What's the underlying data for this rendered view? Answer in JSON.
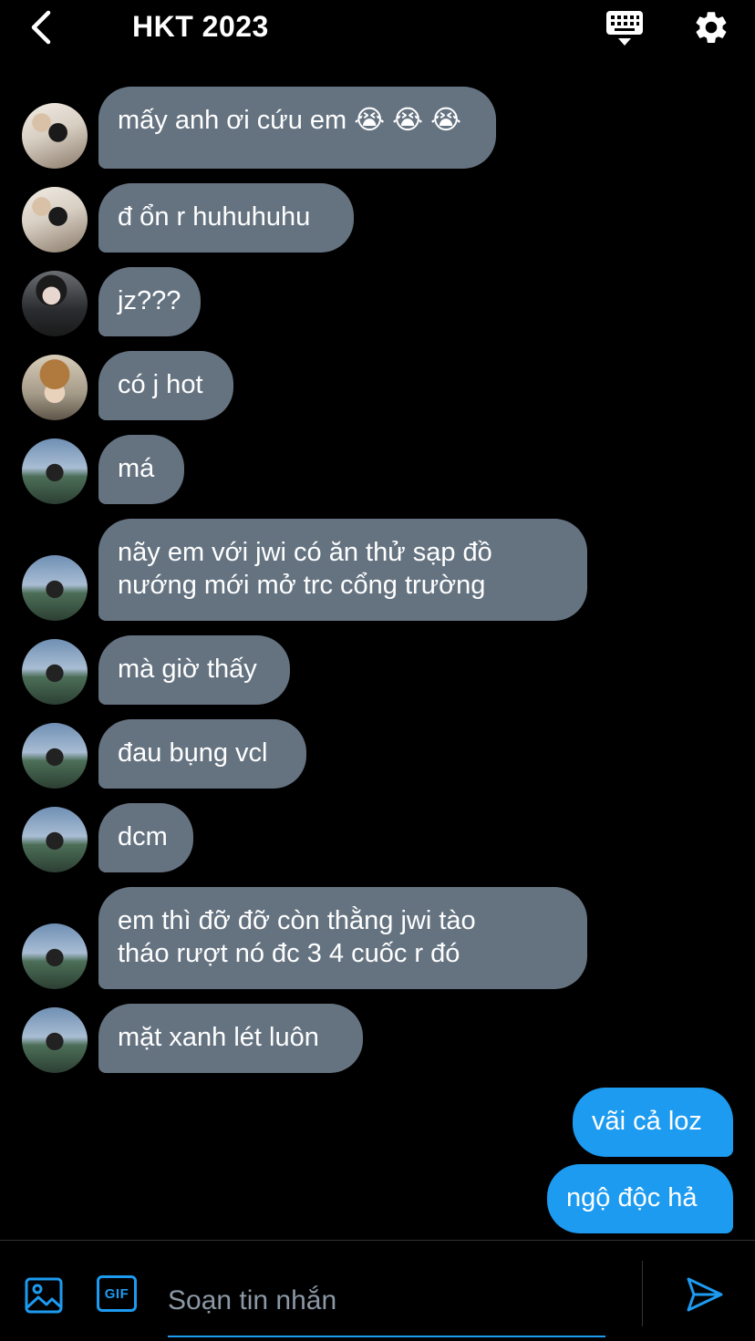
{
  "header": {
    "title": "HKT 2023",
    "icons": {
      "back": "chevron-left-icon",
      "keyboard": "keyboard-icon",
      "settings": "gear-icon"
    }
  },
  "messages": [
    {
      "sender": "other",
      "avatar": "a",
      "text": "mấy anh ơi cứu em 😭 😭 😭"
    },
    {
      "sender": "other",
      "avatar": "a",
      "text": "đ ổn r huhuhuhu"
    },
    {
      "sender": "other",
      "avatar": "b",
      "text": "jz???"
    },
    {
      "sender": "other",
      "avatar": "c",
      "text": "có j hot"
    },
    {
      "sender": "other",
      "avatar": "d",
      "text": "má"
    },
    {
      "sender": "other",
      "avatar": "d",
      "text": "nãy em với jwi có ăn thử sạp đồ\nnướng mới mở trc cổng trường"
    },
    {
      "sender": "other",
      "avatar": "d",
      "text": "mà giờ thấy"
    },
    {
      "sender": "other",
      "avatar": "d",
      "text": "đau bụng vcl"
    },
    {
      "sender": "other",
      "avatar": "d",
      "text": "dcm"
    },
    {
      "sender": "other",
      "avatar": "d",
      "text": "em thì đỡ đỡ còn thằng jwi tào\ntháo rượt nó đc 3 4 cuốc r đó"
    },
    {
      "sender": "other",
      "avatar": "d",
      "text": "mặt xanh lét luôn"
    },
    {
      "sender": "me",
      "text": "vãi cả loz"
    },
    {
      "sender": "me",
      "text": "ngộ độc hả"
    }
  ],
  "composer": {
    "placeholder": "Soạn tin nhắn",
    "gif_label": "GIF",
    "icons": {
      "media": "image-icon",
      "gif": "gif-icon",
      "send": "send-icon"
    }
  },
  "colors": {
    "background": "#000000",
    "incoming_bubble": "#657381",
    "outgoing_bubble": "#1d9bf0",
    "accent": "#1d9bf0"
  }
}
